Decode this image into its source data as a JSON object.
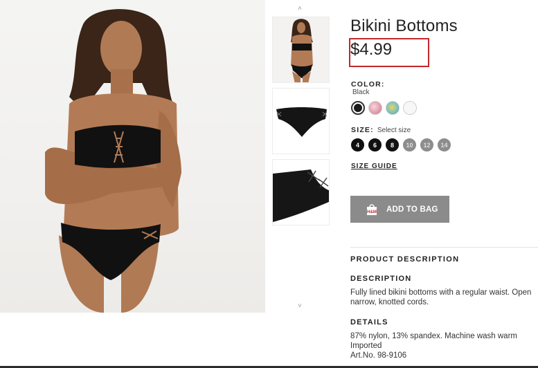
{
  "product": {
    "title": "Bikini Bottoms",
    "price": "$4.99"
  },
  "color": {
    "label": "COLOR:",
    "selected": "Black",
    "swatches": [
      {
        "name": "black",
        "hex": "#1c1c1c"
      },
      {
        "name": "pink-floral",
        "hex": "#e8b7c2"
      },
      {
        "name": "tropical-print",
        "hex": "#9fc8c4"
      },
      {
        "name": "white",
        "hex": "#f6f6f6"
      }
    ]
  },
  "size": {
    "label": "SIZE:",
    "hint": "Select size",
    "options": [
      {
        "label": "4",
        "available": true
      },
      {
        "label": "6",
        "available": true
      },
      {
        "label": "8",
        "available": true
      },
      {
        "label": "10",
        "available": false
      },
      {
        "label": "12",
        "available": false
      },
      {
        "label": "14",
        "available": false
      }
    ]
  },
  "size_guide_label": "SIZE GUIDE",
  "add_to_bag_label": "ADD TO BAG",
  "product_description": {
    "heading": "PRODUCT DESCRIPTION",
    "description_heading": "DESCRIPTION",
    "description_line1": "Fully lined bikini bottoms with a regular waist. Open",
    "description_line2": "narrow, knotted cords.",
    "details_heading": "DETAILS",
    "details_line1": "87% nylon, 13% spandex. Machine wash warm",
    "details_line2": "Imported",
    "details_line3": "Art.No. 98-9106"
  },
  "thumbnails": {
    "up_arrow": "˄",
    "down_arrow": "˅"
  }
}
